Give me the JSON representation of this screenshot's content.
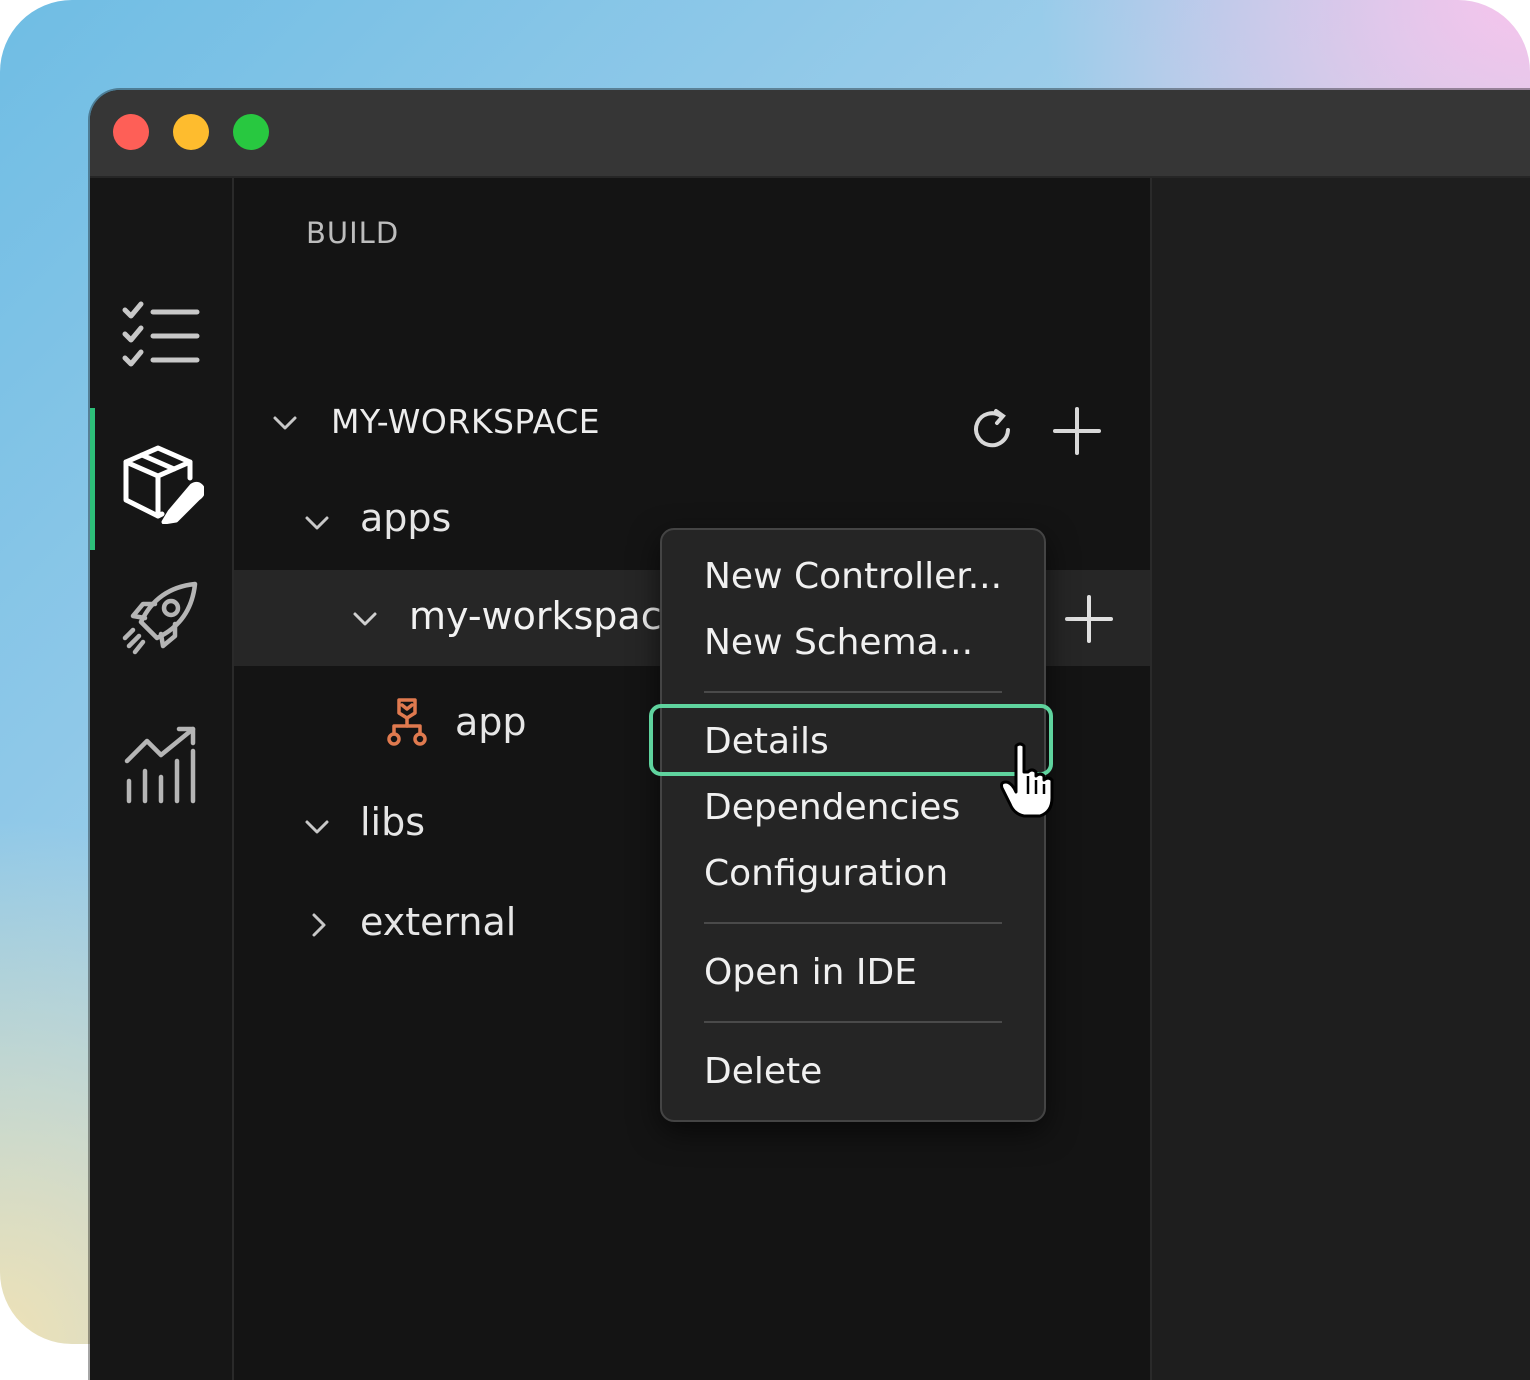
{
  "sidebar": {
    "section_title": "BUILD",
    "workspace": {
      "title": "MY-WORKSPACE",
      "refresh_icon": "refresh-icon",
      "add_icon": "plus-icon"
    },
    "tree": {
      "apps": "apps",
      "project": "my-workspace",
      "app": "app",
      "libs": "libs",
      "external": "external"
    }
  },
  "activity_bar": {
    "items": [
      "tasks-icon",
      "package-edit-icon",
      "rocket-icon",
      "analytics-icon"
    ],
    "active_index": 1
  },
  "context_menu": {
    "items": [
      "New Controller...",
      "New Schema...",
      "Details",
      "Dependencies",
      "Configuration",
      "Open in IDE",
      "Delete"
    ],
    "highlighted": "Details"
  },
  "colors": {
    "accent": "#2dbf79",
    "highlight_ring": "#5fd39e",
    "app_icon": "#e07a4f"
  }
}
